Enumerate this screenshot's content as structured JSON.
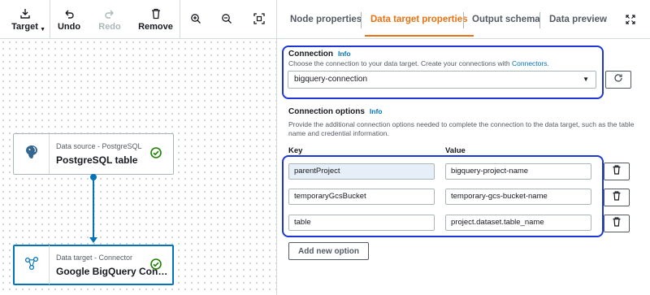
{
  "toolbar": {
    "target_label": "Target",
    "undo_label": "Undo",
    "redo_label": "Redo",
    "remove_label": "Remove",
    "icons": [
      "download-icon",
      "undo-icon",
      "redo-icon",
      "trash-icon",
      "zoom-in-icon",
      "zoom-out-icon",
      "fit-to-screen-icon"
    ]
  },
  "nodes": {
    "source": {
      "subtitle": "Data source - PostgreSQL",
      "title": "PostgreSQL table",
      "icon": "postgresql-icon",
      "status": "success-check-icon"
    },
    "target": {
      "subtitle": "Data target - Connector",
      "title": "Google BigQuery Con…",
      "icon": "connector-icon",
      "status": "success-check-icon",
      "selected": true
    }
  },
  "tabs": [
    {
      "label": "Node properties",
      "active": false
    },
    {
      "label": "Data target properties",
      "active": true
    },
    {
      "label": "Output schema",
      "active": false
    },
    {
      "label": "Data preview",
      "active": false
    }
  ],
  "connection": {
    "label": "Connection",
    "info": "Info",
    "description_prefix": "Choose the connection to your data target. Create your connections with ",
    "description_link": "Connectors",
    "description_suffix": ".",
    "selected_value": "bigquery-connection"
  },
  "connection_options": {
    "label": "Connection options",
    "info": "Info",
    "description": "Provide the additional connection options needed to complete the connection to the data target, such as the table name and credential information.",
    "key_header": "Key",
    "value_header": "Value",
    "rows": [
      {
        "key": "parentProject",
        "value": "bigquery-project-name"
      },
      {
        "key": "temporaryGcsBucket",
        "value": "temporary-gcs-bucket-name"
      },
      {
        "key": "table",
        "value": "project.dataset.table_name"
      }
    ],
    "add_button": "Add new option"
  },
  "colors": {
    "accent": "#ec7211",
    "link": "#0073bb",
    "highlight": "#1d37d6",
    "success": "#1d8102"
  }
}
